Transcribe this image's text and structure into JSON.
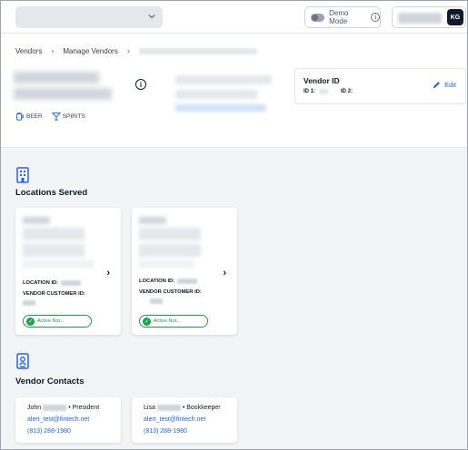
{
  "topbar": {
    "demo_mode_label": "Demo Mode",
    "avatar_initials": "KG"
  },
  "breadcrumb": {
    "items": [
      "Vendors",
      "Manage Vendors"
    ]
  },
  "vendor": {
    "tags": [
      "BEER",
      "SPIRITS"
    ],
    "vendor_id_title": "Vendor ID",
    "id1_label": "ID 1:",
    "id2_label": "ID 2:",
    "edit_label": "Edit"
  },
  "locations": {
    "title": "Locations Served",
    "cards": [
      {
        "location_id_label": "LOCATION ID:",
        "vendor_customer_id_label": "VENDOR CUSTOMER ID:",
        "status": "Active Not..."
      },
      {
        "location_id_label": "LOCATION ID:",
        "vendor_customer_id_label": "VENDOR CUSTOMER ID:",
        "status": "Active Not..."
      }
    ]
  },
  "contacts": {
    "title": "Vendor Contacts",
    "cards": [
      {
        "first_name": "John",
        "role": "• President",
        "email": "alert_test@fintech.net",
        "phone": "(813) 288-1980"
      },
      {
        "first_name": "Lisa",
        "role": "• Bookkeeper",
        "email": "alert_test@fintech.net",
        "phone": "(813) 288-1980"
      }
    ]
  },
  "colors": {
    "accent": "#2563eb",
    "success": "#16a34a",
    "background": "#f3f4f6"
  }
}
